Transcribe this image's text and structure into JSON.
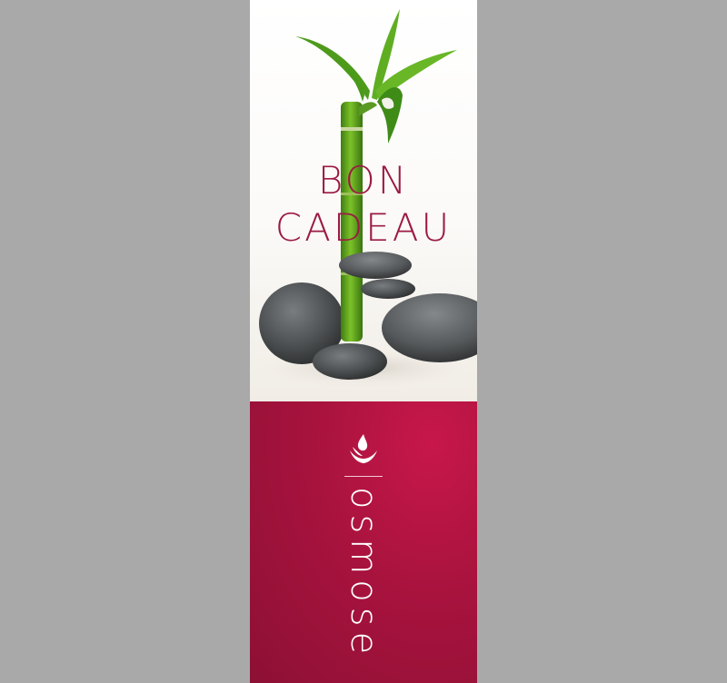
{
  "colors": {
    "background": "#a9a9a9",
    "title": "#9c1a44",
    "panel": "#a8133e",
    "brand": "#ffffff"
  },
  "card": {
    "title_line_1": "BON",
    "title_line_2": "CADEAU",
    "brand_name": "osmose",
    "image_icon": "bamboo-and-stones-image",
    "logo_icon": "lotus-drop-logo-icon"
  }
}
